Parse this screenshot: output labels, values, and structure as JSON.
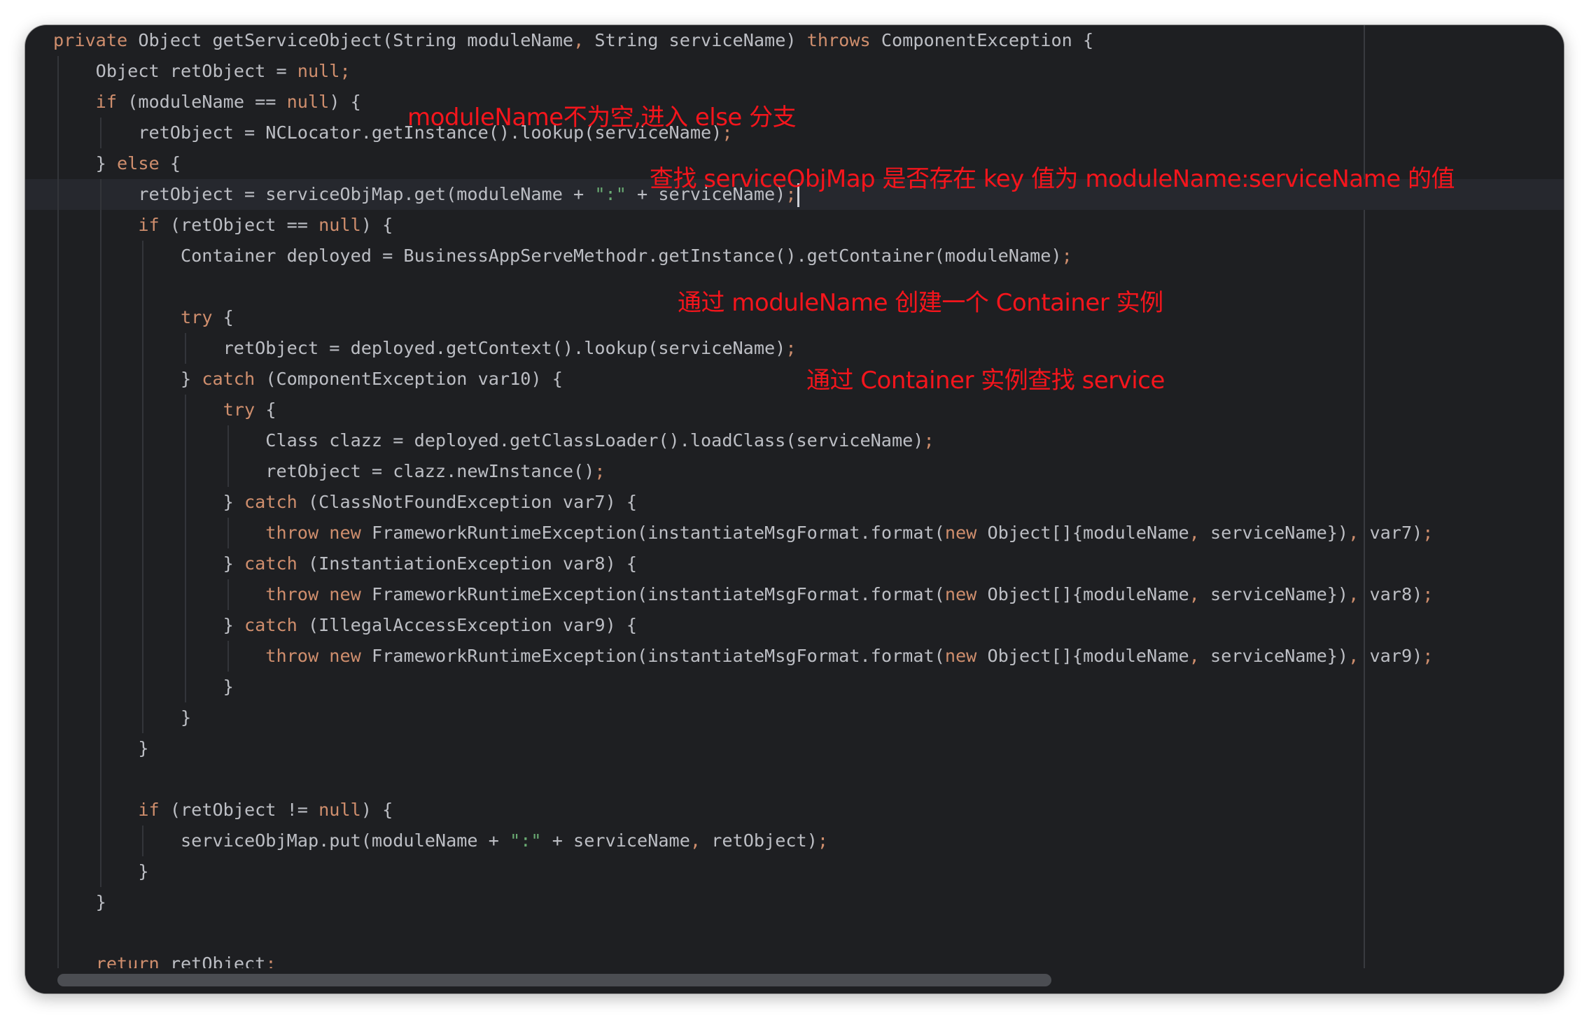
{
  "editor": {
    "lines": [
      [
        [
          "kw",
          "private "
        ],
        [
          "t",
          "Object getServiceObject(String moduleName"
        ],
        [
          "p",
          ","
        ],
        [
          "t",
          " String serviceName) "
        ],
        [
          "kw",
          "throws "
        ],
        [
          "t",
          "ComponentException {"
        ]
      ],
      [
        [
          "t",
          "    Object retObject = "
        ],
        [
          "kw",
          "null"
        ],
        [
          "p",
          ";"
        ]
      ],
      [
        [
          "t",
          "    "
        ],
        [
          "kw",
          "if "
        ],
        [
          "t",
          "(moduleName == "
        ],
        [
          "kw",
          "null"
        ],
        [
          "t",
          ") {"
        ]
      ],
      [
        [
          "t",
          "        retObject = NCLocator.getInstance().lookup(serviceName)"
        ],
        [
          "p",
          ";"
        ]
      ],
      [
        [
          "t",
          "    } "
        ],
        [
          "kw",
          "else "
        ],
        [
          "t",
          "{"
        ]
      ],
      [
        [
          "t",
          "        retObject = serviceObjMap.get(moduleName + "
        ],
        [
          "s",
          "\":\""
        ],
        [
          "t",
          " + serviceName)"
        ],
        [
          "p",
          ";"
        ]
      ],
      [
        [
          "t",
          "        "
        ],
        [
          "kw",
          "if "
        ],
        [
          "t",
          "(retObject == "
        ],
        [
          "kw",
          "null"
        ],
        [
          "t",
          ") {"
        ]
      ],
      [
        [
          "t",
          "            Container deployed = BusinessAppServeMethodr.getInstance().getContainer(moduleName)"
        ],
        [
          "p",
          ";"
        ]
      ],
      [
        [
          "t",
          ""
        ]
      ],
      [
        [
          "t",
          "            "
        ],
        [
          "kw",
          "try "
        ],
        [
          "t",
          "{"
        ]
      ],
      [
        [
          "t",
          "                retObject = deployed.getContext().lookup(serviceName)"
        ],
        [
          "p",
          ";"
        ]
      ],
      [
        [
          "t",
          "            } "
        ],
        [
          "kw",
          "catch "
        ],
        [
          "t",
          "(ComponentException var10) {"
        ]
      ],
      [
        [
          "t",
          "                "
        ],
        [
          "kw",
          "try "
        ],
        [
          "t",
          "{"
        ]
      ],
      [
        [
          "t",
          "                    Class clazz = deployed.getClassLoader().loadClass(serviceName)"
        ],
        [
          "p",
          ";"
        ]
      ],
      [
        [
          "t",
          "                    retObject = clazz.newInstance()"
        ],
        [
          "p",
          ";"
        ]
      ],
      [
        [
          "t",
          "                } "
        ],
        [
          "kw",
          "catch "
        ],
        [
          "t",
          "(ClassNotFoundException var7) {"
        ]
      ],
      [
        [
          "t",
          "                    "
        ],
        [
          "kw",
          "throw new "
        ],
        [
          "t",
          "FrameworkRuntimeException(instantiateMsgFormat.format("
        ],
        [
          "kw",
          "new "
        ],
        [
          "t",
          "Object[]{moduleName"
        ],
        [
          "p",
          ","
        ],
        [
          "t",
          " serviceName})"
        ],
        [
          "p",
          ","
        ],
        [
          "t",
          " var7)"
        ],
        [
          "p",
          ";"
        ]
      ],
      [
        [
          "t",
          "                } "
        ],
        [
          "kw",
          "catch "
        ],
        [
          "t",
          "(InstantiationException var8) {"
        ]
      ],
      [
        [
          "t",
          "                    "
        ],
        [
          "kw",
          "throw new "
        ],
        [
          "t",
          "FrameworkRuntimeException(instantiateMsgFormat.format("
        ],
        [
          "kw",
          "new "
        ],
        [
          "t",
          "Object[]{moduleName"
        ],
        [
          "p",
          ","
        ],
        [
          "t",
          " serviceName})"
        ],
        [
          "p",
          ","
        ],
        [
          "t",
          " var8)"
        ],
        [
          "p",
          ";"
        ]
      ],
      [
        [
          "t",
          "                } "
        ],
        [
          "kw",
          "catch "
        ],
        [
          "t",
          "(IllegalAccessException var9) {"
        ]
      ],
      [
        [
          "t",
          "                    "
        ],
        [
          "kw",
          "throw new "
        ],
        [
          "t",
          "FrameworkRuntimeException(instantiateMsgFormat.format("
        ],
        [
          "kw",
          "new "
        ],
        [
          "t",
          "Object[]{moduleName"
        ],
        [
          "p",
          ","
        ],
        [
          "t",
          " serviceName})"
        ],
        [
          "p",
          ","
        ],
        [
          "t",
          " var9)"
        ],
        [
          "p",
          ";"
        ]
      ],
      [
        [
          "t",
          "                }"
        ]
      ],
      [
        [
          "t",
          "            }"
        ]
      ],
      [
        [
          "t",
          "        }"
        ]
      ],
      [
        [
          "t",
          ""
        ]
      ],
      [
        [
          "t",
          "        "
        ],
        [
          "kw",
          "if "
        ],
        [
          "t",
          "(retObject != "
        ],
        [
          "kw",
          "null"
        ],
        [
          "t",
          ") {"
        ]
      ],
      [
        [
          "t",
          "            serviceObjMap.put(moduleName + "
        ],
        [
          "s",
          "\":\""
        ],
        [
          "t",
          " + serviceName"
        ],
        [
          "p",
          ","
        ],
        [
          "t",
          " retObject)"
        ],
        [
          "p",
          ";"
        ]
      ],
      [
        [
          "t",
          "        }"
        ]
      ],
      [
        [
          "t",
          "    }"
        ]
      ],
      [
        [
          "t",
          ""
        ]
      ],
      [
        [
          "t",
          "    "
        ],
        [
          "kw",
          "return "
        ],
        [
          "t",
          "retObject"
        ],
        [
          "p",
          ";"
        ]
      ]
    ],
    "caret_line": 5
  },
  "annotations": [
    "moduleName不为空,进入 else 分支",
    "查找 serviceObjMap 是否存在 key 值为 moduleName:serviceName 的值",
    "通过 moduleName 创建一个 Container 实例",
    "通过 Container 实例查找 service"
  ],
  "colors": {
    "background": "#1e1f22",
    "keyword": "#cf8e6d",
    "identifier": "#bcbec4",
    "string": "#6aab73",
    "annotation": "#f5151c"
  }
}
